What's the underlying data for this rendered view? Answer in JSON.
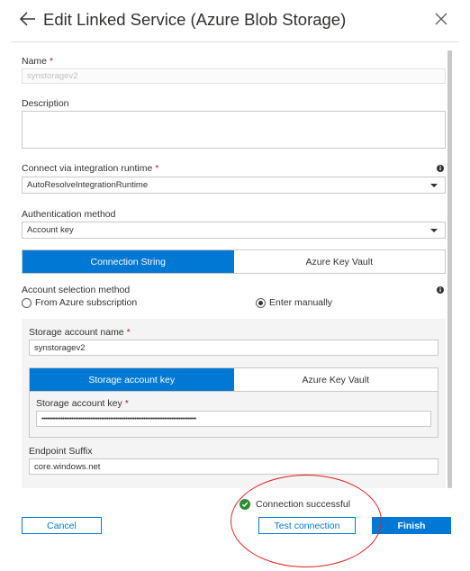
{
  "header": {
    "title": "Edit Linked Service (Azure Blob Storage)"
  },
  "name": {
    "label": "Name",
    "required": "*",
    "value": "synstoragev2"
  },
  "description": {
    "label": "Description",
    "value": ""
  },
  "runtime": {
    "label": "Connect via integration runtime",
    "required": "*",
    "selected": "AutoResolveIntegrationRuntime",
    "info": "i"
  },
  "auth": {
    "label": "Authentication method",
    "selected": "Account key"
  },
  "connection_toggle": {
    "options": [
      "Connection String",
      "Azure Key Vault"
    ],
    "active": "Connection String"
  },
  "account_selection": {
    "label": "Account selection method",
    "info": "i",
    "options": [
      "From Azure subscription",
      "Enter manually"
    ],
    "selected": "Enter manually"
  },
  "storage_account": {
    "label": "Storage account name",
    "required": "*",
    "value": "synstoragev2"
  },
  "key_toggle": {
    "options": [
      "Storage account key",
      "Azure Key Vault"
    ],
    "active": "Storage account key"
  },
  "storage_key": {
    "label": "Storage account key",
    "required": "*",
    "value": "••••••••••••••••••••••••••••••••••••••••••••••••••••••••••••••••••••••••••••••••••••••••"
  },
  "endpoint": {
    "label": "Endpoint Suffix",
    "value": "core.windows.net"
  },
  "footer": {
    "status": "Connection successful",
    "cancel": "Cancel",
    "test": "Test connection",
    "finish": "Finish"
  },
  "colors": {
    "accent": "#0078d4",
    "success": "#2d8a31",
    "required": "#a4262c",
    "annotation": "#e02020"
  }
}
